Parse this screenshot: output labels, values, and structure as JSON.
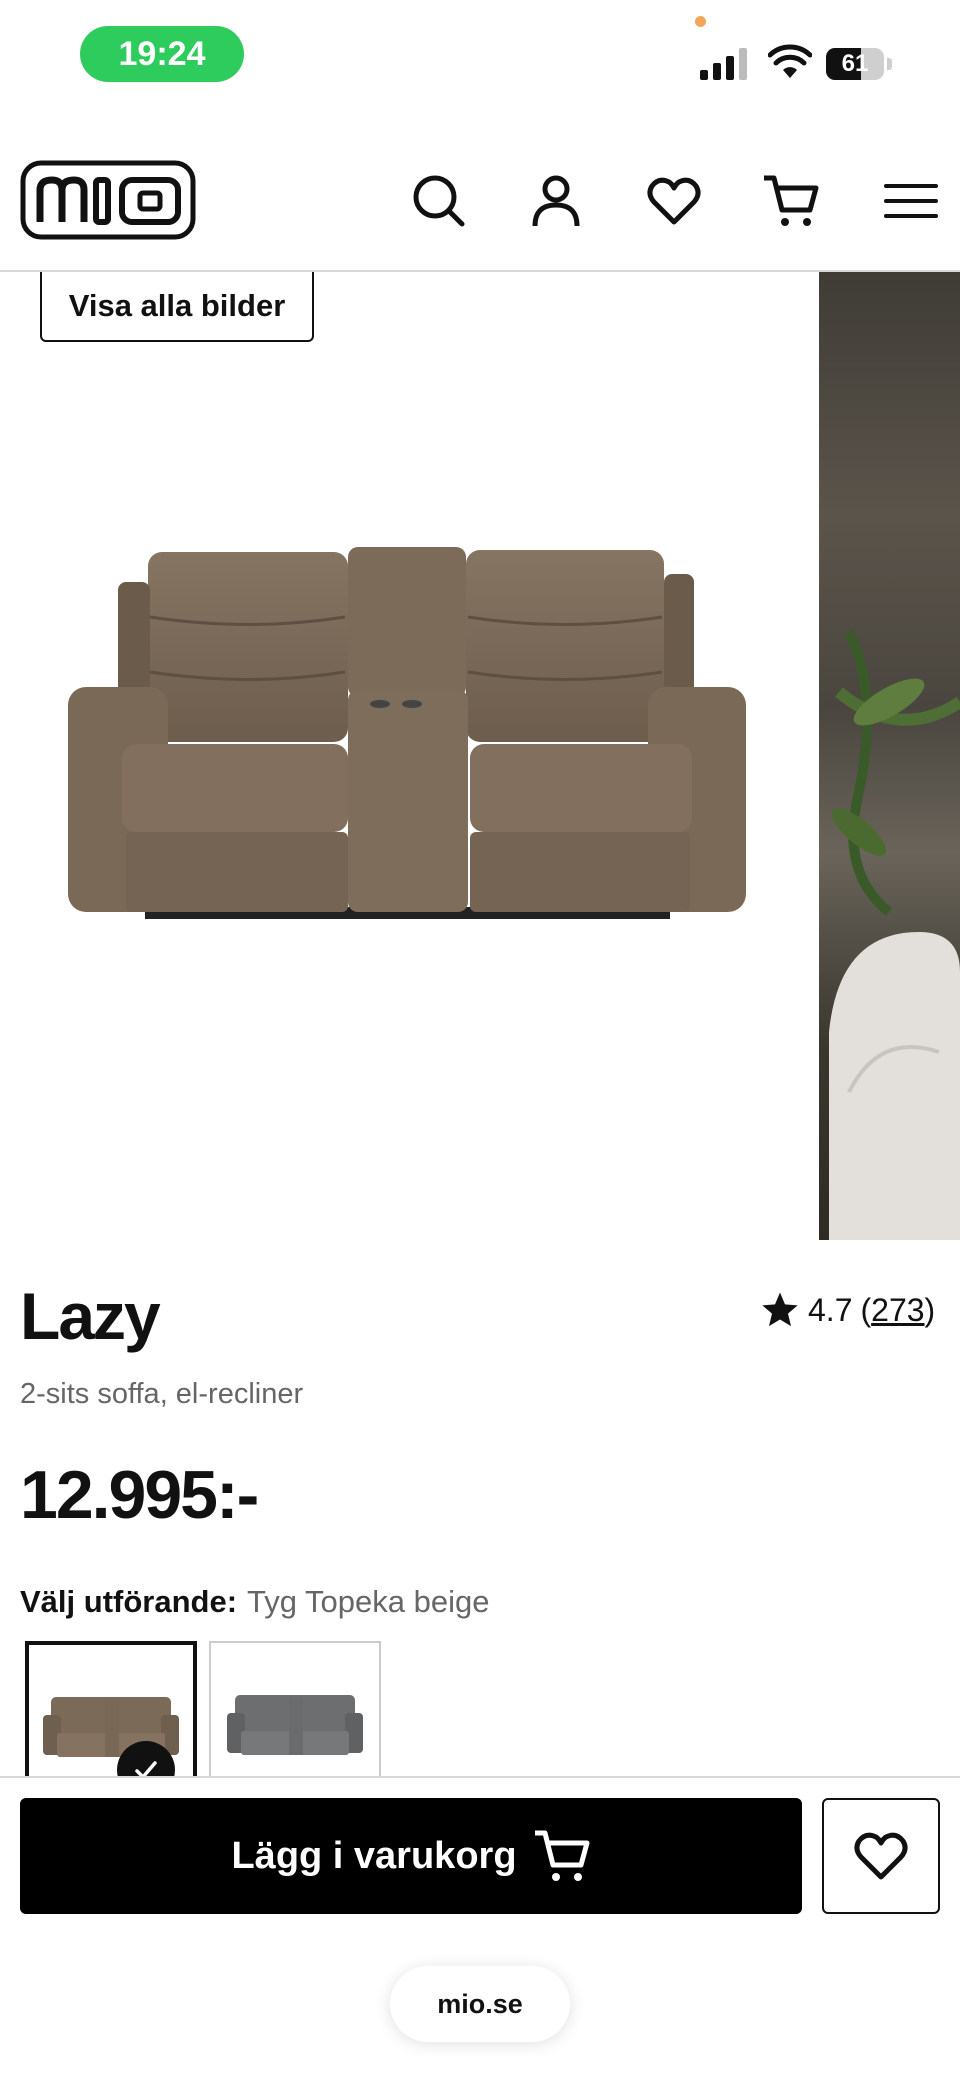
{
  "status_bar": {
    "time": "19:24",
    "battery": "61",
    "battery_level": 0.61
  },
  "header": {
    "logo_text": "mio",
    "icons": [
      "search-icon",
      "account-icon",
      "wishlist-heart-icon",
      "cart-icon",
      "menu-icon"
    ]
  },
  "gallery": {
    "show_all_label": "Visa alla bilder"
  },
  "product": {
    "title": "Lazy",
    "subtitle": "2-sits soffa, el-recliner",
    "price": "12.995:-",
    "rating": {
      "value": "4.7",
      "count_open": "(",
      "count": "273",
      "count_close": ")"
    }
  },
  "variant": {
    "label": "Välj utförande:",
    "selected": "Tyg Topeka beige",
    "colors": {
      "beige": "#7b6a58",
      "grey": "#6d6e70"
    }
  },
  "cta": {
    "add_to_cart": "Lägg i varukorg"
  },
  "browser": {
    "url": "mio.se"
  },
  "colors": {
    "status_pill": "#2ecc5c",
    "primary": "#000000"
  }
}
